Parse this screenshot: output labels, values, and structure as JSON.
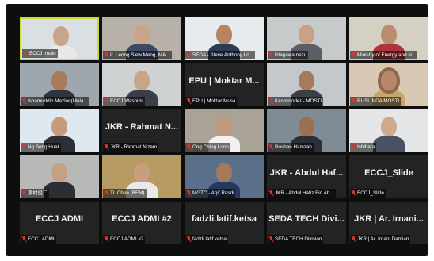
{
  "tiles": [
    {
      "name": "ECCJ_main",
      "type": "video",
      "active": true,
      "bg": "#d9dfe3",
      "skin": "#c8a58a",
      "shirt": "#e8e8e8"
    },
    {
      "name": "Ir. Leong Siew Meng, MA...",
      "type": "video",
      "bg": "#b7b1aa",
      "skin": "#c9a488",
      "shirt": "#3d4a66"
    },
    {
      "name": "SEDA - Steve Anthony Lo...",
      "type": "video",
      "bg": "#e7ebee",
      "skin": "#b58562",
      "shirt": "#2d3b57"
    },
    {
      "name": "kitagawa nezu",
      "type": "video",
      "bg": "#c7cacb",
      "skin": "#c9a285",
      "shirt": "#5a5e66"
    },
    {
      "name": "Ministry of Energy and N...",
      "type": "video",
      "bg": "#d5d0c4",
      "skin": "#b98d6e",
      "shirt": "#b0343b"
    },
    {
      "name": "Ishamuddin Mazlan(Mala...",
      "type": "video",
      "bg": "#9ea6ae",
      "skin": "#a87a5b",
      "shirt": "#2e3340"
    },
    {
      "name": "ECCJ Washimi",
      "type": "video",
      "bg": "#cfd2d3",
      "skin": "#c9a487",
      "shirt": "#3a3f47"
    },
    {
      "name": "EPU | Moktar Musa",
      "big": "EPU | Moktar M...",
      "type": "text"
    },
    {
      "name": "Keshminder - MOSTI",
      "type": "video",
      "bg": "#c4c8cb",
      "skin": "#a67b5d",
      "shirt": "#3c3f43"
    },
    {
      "name": "RUSLINDA MOSTI",
      "type": "video",
      "bg": "#d8c8b4",
      "skin": "#b9876a",
      "shirt": "#c9a46b",
      "hijab": true
    },
    {
      "name": "Ng Seng Huat",
      "type": "video",
      "bg": "#dfe7ef",
      "skin": "#c59b7a",
      "shirt": "#2e2f34"
    },
    {
      "name": "JKR - Rahmat Nizam",
      "big": "JKR - Rahmat N...",
      "type": "text"
    },
    {
      "name": "Ong Ching Loon",
      "type": "video",
      "bg": "#a9a396",
      "skin": "#c29a7b",
      "shirt": "#f1f1f1"
    },
    {
      "name": "Roshan Hamzah",
      "type": "video",
      "bg": "#7f8b95",
      "skin": "#9c6f52",
      "shirt": "#2b3038"
    },
    {
      "name": "Ishihara",
      "type": "video",
      "bg": "#e4e6e7",
      "skin": "#cfa98c",
      "shirt": "#4a5160"
    },
    {
      "name": "東村俊二",
      "type": "video",
      "bg": "#b6b9b5",
      "skin": "#c5a084",
      "shirt": "#2b2e33"
    },
    {
      "name": "TL Chen (BEM)",
      "type": "video",
      "bg": "#b89b63",
      "skin": "#c79f7e",
      "shirt": "#e9e9e9"
    },
    {
      "name": "MGTC - Aqif Rasdi",
      "type": "video",
      "bg": "#5a6f8a",
      "skin": "#a47a5b",
      "shirt": "#24395f"
    },
    {
      "name": "JKR - Abdul Hafiz Bin Ab...",
      "big": "JKR - Abdul Haf...",
      "type": "text"
    },
    {
      "name": "ECCJ_Slide",
      "big": "ECCJ_Slide",
      "type": "text"
    },
    {
      "name": "ECCJ  ADMI",
      "big": "ECCJ  ADMI",
      "type": "text"
    },
    {
      "name": "ECCJ  ADMI #2",
      "big": "ECCJ  ADMI #2",
      "type": "text"
    },
    {
      "name": "fadzli.latif.ketsa",
      "big": "fadzli.latif.ketsa",
      "type": "text"
    },
    {
      "name": "SEDA TECH Division",
      "big": "SEDA TECH Divi...",
      "type": "text"
    },
    {
      "name": "JKR | Ar. Irnani Damian",
      "big": "JKR | Ar. Irnani...",
      "type": "text"
    }
  ],
  "colors": {
    "active_border": "#c9dc2b",
    "mute": "#e0322c",
    "tile_bg": "#232323"
  }
}
